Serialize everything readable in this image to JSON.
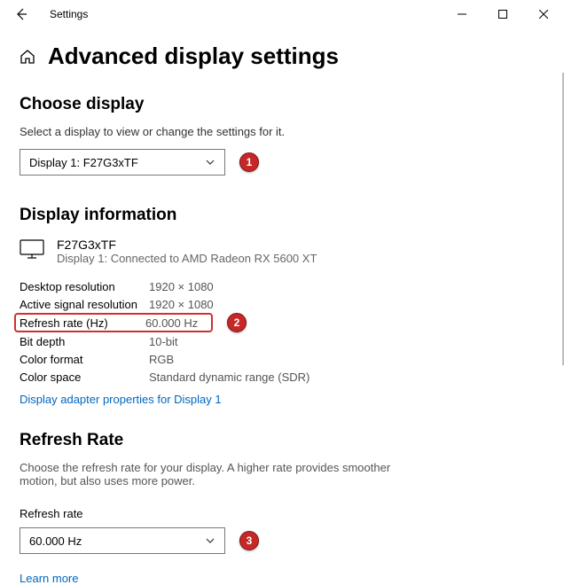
{
  "titlebar": {
    "app_name": "Settings"
  },
  "header": {
    "title": "Advanced display settings"
  },
  "choose_display_section": {
    "title": "Choose display",
    "helper": "Select a display to view or change the settings for it.",
    "dropdown_value": "Display 1: F27G3xTF"
  },
  "display_info_section": {
    "title": "Display information",
    "monitor_name": "F27G3xTF",
    "monitor_sub": "Display 1: Connected to AMD Radeon RX 5600 XT",
    "rows": [
      {
        "key": "Desktop resolution",
        "val": "1920 × 1080"
      },
      {
        "key": "Active signal resolution",
        "val": "1920 × 1080"
      },
      {
        "key": "Refresh rate (Hz)",
        "val": "60.000 Hz"
      },
      {
        "key": "Bit depth",
        "val": "10-bit"
      },
      {
        "key": "Color format",
        "val": "RGB"
      },
      {
        "key": "Color space",
        "val": "Standard dynamic range (SDR)"
      }
    ],
    "link": "Display adapter properties for Display 1"
  },
  "refresh_rate_section": {
    "title": "Refresh Rate",
    "helper": "Choose the refresh rate for your display. A higher rate provides smoother motion, but also uses more power.",
    "field_label": "Refresh rate",
    "dropdown_value": "60.000 Hz",
    "learn_more": "Learn more"
  },
  "annotations": {
    "a1": "1",
    "a2": "2",
    "a3": "3"
  }
}
